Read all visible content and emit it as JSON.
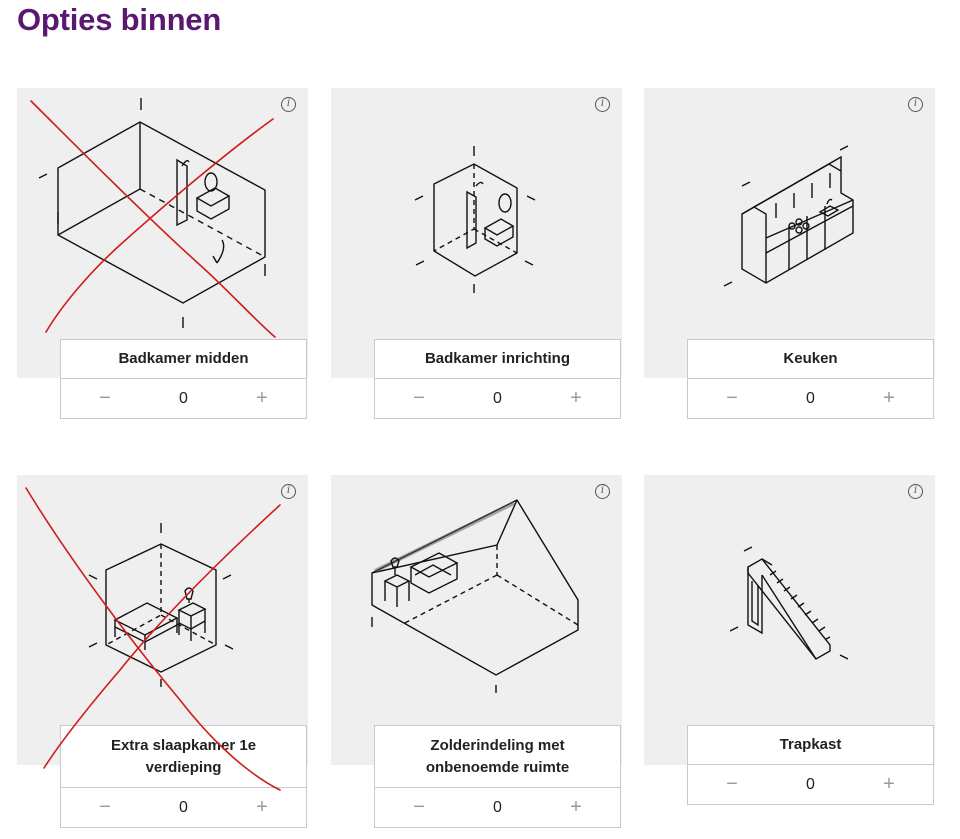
{
  "page": {
    "title": "Opties binnen"
  },
  "cards": [
    {
      "label": "Badkamer midden",
      "quantity": "0",
      "minus": "−",
      "plus": "+",
      "info": "i"
    },
    {
      "label": "Badkamer inrichting",
      "quantity": "0",
      "minus": "−",
      "plus": "+",
      "info": "i"
    },
    {
      "label": "Keuken",
      "quantity": "0",
      "minus": "−",
      "plus": "+",
      "info": "i"
    },
    {
      "label": "Extra slaapkamer 1e verdieping",
      "quantity": "0",
      "minus": "−",
      "plus": "+",
      "info": "i"
    },
    {
      "label": "Zolderindeling met onbenoemde ruimte",
      "quantity": "0",
      "minus": "−",
      "plus": "+",
      "info": "i"
    },
    {
      "label": "Trapkast",
      "quantity": "0",
      "minus": "−",
      "plus": "+",
      "info": "i"
    }
  ],
  "colors": {
    "title": "#5b1870",
    "tile": "#efefef",
    "cross": "#d01c1c",
    "stroke": "#111111"
  }
}
